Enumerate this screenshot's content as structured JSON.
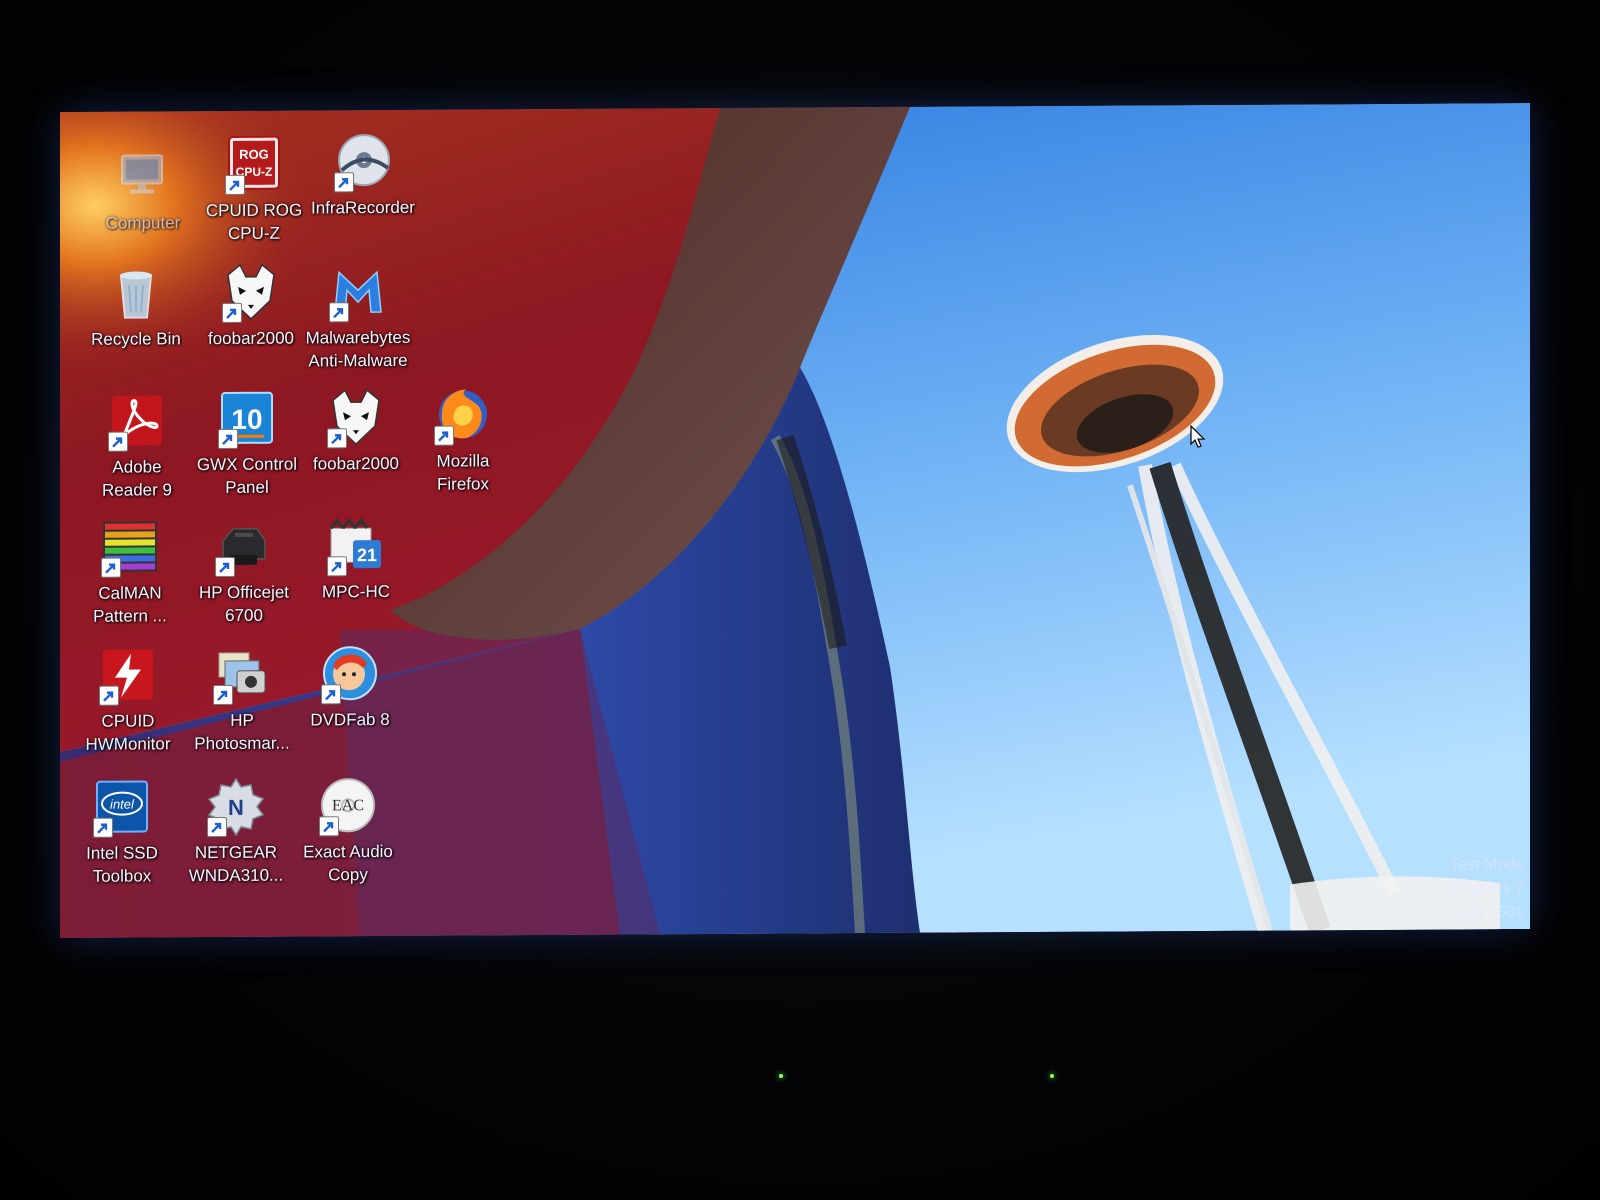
{
  "desktop": {
    "icons": [
      {
        "id": "computer",
        "label": "Computer",
        "icon": "computer-icon",
        "faded": true
      },
      {
        "id": "cpuz",
        "label": "CPUID ROG\nCPU-Z",
        "icon": "cpuz-icon",
        "badge_text": "ROG\nCPU-Z"
      },
      {
        "id": "infrarecorder",
        "label": "InfraRecorder",
        "icon": "disc-icon"
      },
      {
        "id": "recycle",
        "label": "Recycle Bin",
        "icon": "recycle-bin-icon"
      },
      {
        "id": "foobar1",
        "label": "foobar2000",
        "icon": "foobar-icon"
      },
      {
        "id": "malwarebytes",
        "label": "Malwarebytes\nAnti-Malware",
        "icon": "malwarebytes-icon"
      },
      {
        "id": "adobe",
        "label": "Adobe\nReader 9",
        "icon": "adobe-reader-icon"
      },
      {
        "id": "gwx",
        "label": "GWX Control\nPanel",
        "icon": "gwx-icon",
        "badge_text": "10"
      },
      {
        "id": "foobar2",
        "label": "foobar2000",
        "icon": "foobar-icon"
      },
      {
        "id": "firefox",
        "label": "Mozilla\nFirefox",
        "icon": "firefox-icon"
      },
      {
        "id": "calman",
        "label": "CalMAN\nPattern ...",
        "icon": "calman-icon"
      },
      {
        "id": "hpofficejet",
        "label": "HP Officejet\n6700",
        "icon": "printer-icon"
      },
      {
        "id": "mpchc",
        "label": "MPC-HC",
        "icon": "mpc-hc-icon",
        "badge_text": "21"
      },
      {
        "id": "hwmonitor",
        "label": "CPUID\nHWMonitor",
        "icon": "hwmonitor-icon"
      },
      {
        "id": "hpphotosmart",
        "label": "HP\nPhotosmar...",
        "icon": "photosmart-icon"
      },
      {
        "id": "dvdfab",
        "label": "DVDFab 8",
        "icon": "dvdfab-icon"
      },
      {
        "id": "intelssd",
        "label": "Intel SSD\nToolbox",
        "icon": "intel-icon",
        "badge_text": "intel"
      },
      {
        "id": "netgear",
        "label": "NETGEAR\nWNDA310...",
        "icon": "netgear-icon",
        "badge_text": "N"
      },
      {
        "id": "eac",
        "label": "Exact Audio\nCopy",
        "icon": "eac-icon",
        "badge_text": "EAC"
      }
    ]
  },
  "watermark": {
    "line1": "Test Mode",
    "line2": "Windows 7",
    "line3": "Build 7601"
  },
  "colors": {
    "sky_top": "#2f7ee0",
    "sky_bottom": "#9fd2ff",
    "building_red": "#8e1421",
    "building_orange": "#d9661c",
    "building_purple": "#4a2f7a",
    "building_blue": "#2a3f9a"
  }
}
